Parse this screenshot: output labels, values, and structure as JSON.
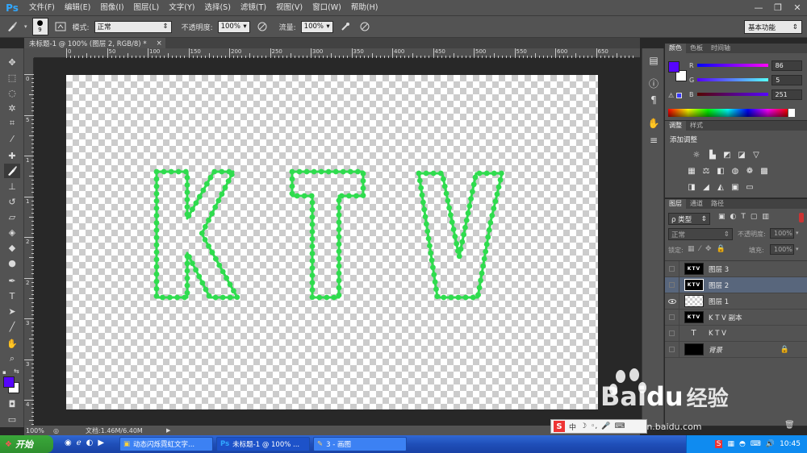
{
  "app": {
    "logo": "Ps",
    "menus": [
      "文件(F)",
      "编辑(E)",
      "图像(I)",
      "图层(L)",
      "文字(Y)",
      "选择(S)",
      "滤镜(T)",
      "视图(V)",
      "窗口(W)",
      "帮助(H)"
    ],
    "window_controls": [
      "—",
      "❐",
      "✕"
    ]
  },
  "options": {
    "brush_size": "9",
    "mode_label": "模式:",
    "mode_value": "正常",
    "opacity_label": "不透明度:",
    "opacity_value": "100%",
    "flow_label": "流量:",
    "flow_value": "100%",
    "workspace": "基本功能"
  },
  "document": {
    "tab_title": "未标题-1 @ 100% (图层 2, RGB/8) *",
    "tab_close": "×",
    "text_letters": [
      "K",
      "T",
      "V"
    ],
    "stroke_color": "#2fdc4e"
  },
  "rulers": {
    "h_numbers": [
      "0",
      "50",
      "100",
      "150",
      "200",
      "250",
      "300",
      "350",
      "400",
      "450",
      "500",
      "550",
      "600",
      "650"
    ],
    "v_numbers": [
      "0",
      "5",
      "1",
      "1",
      "2",
      "2",
      "3",
      "3",
      "4"
    ]
  },
  "status": {
    "zoom": "100%",
    "doc_info": "文档:1.46M/6.40M"
  },
  "color_panel": {
    "tabs": [
      "颜色",
      "色板",
      "时间轴"
    ],
    "foreground": "#5605fb",
    "background": "#ffffff",
    "channels": [
      {
        "name": "R",
        "value": "86"
      },
      {
        "name": "G",
        "value": "5"
      },
      {
        "name": "B",
        "value": "251"
      }
    ]
  },
  "adjust_panel": {
    "tabs": [
      "调整",
      "样式"
    ],
    "title": "添加调整"
  },
  "layers_panel": {
    "tabs": [
      "图层",
      "通道",
      "路径"
    ],
    "filter_label": "ρ 类型",
    "blend_mode": "正常",
    "opacity_label": "不透明度:",
    "opacity_value": "100%",
    "lock_label": "锁定:",
    "fill_label": "填充:",
    "fill_value": "100%",
    "layers": [
      {
        "name": "图层 3",
        "thumb": "KTV",
        "visible": false,
        "selected": false,
        "type": "black"
      },
      {
        "name": "图层 2",
        "thumb": "KTV",
        "visible": false,
        "selected": true,
        "type": "black"
      },
      {
        "name": "图层 1",
        "thumb": "",
        "visible": true,
        "selected": false,
        "type": "trans"
      },
      {
        "name": "K T V 副本",
        "thumb": "KTV",
        "visible": false,
        "selected": false,
        "type": "black"
      },
      {
        "name": "K T V",
        "thumb": "T",
        "visible": false,
        "selected": false,
        "type": "text"
      },
      {
        "name": "背景",
        "thumb": "",
        "visible": false,
        "selected": false,
        "type": "bg"
      }
    ]
  },
  "taskbar": {
    "start": "开始",
    "tasks": [
      "动态闪烁霓虹文字...",
      "未标题-1 @ 100% ...",
      "3 - 画图"
    ],
    "clock": "10:45"
  },
  "watermark": {
    "brand": "Bai",
    "brand2": "du",
    "cn": "经验",
    "url": "jingyan.baidu.com"
  }
}
